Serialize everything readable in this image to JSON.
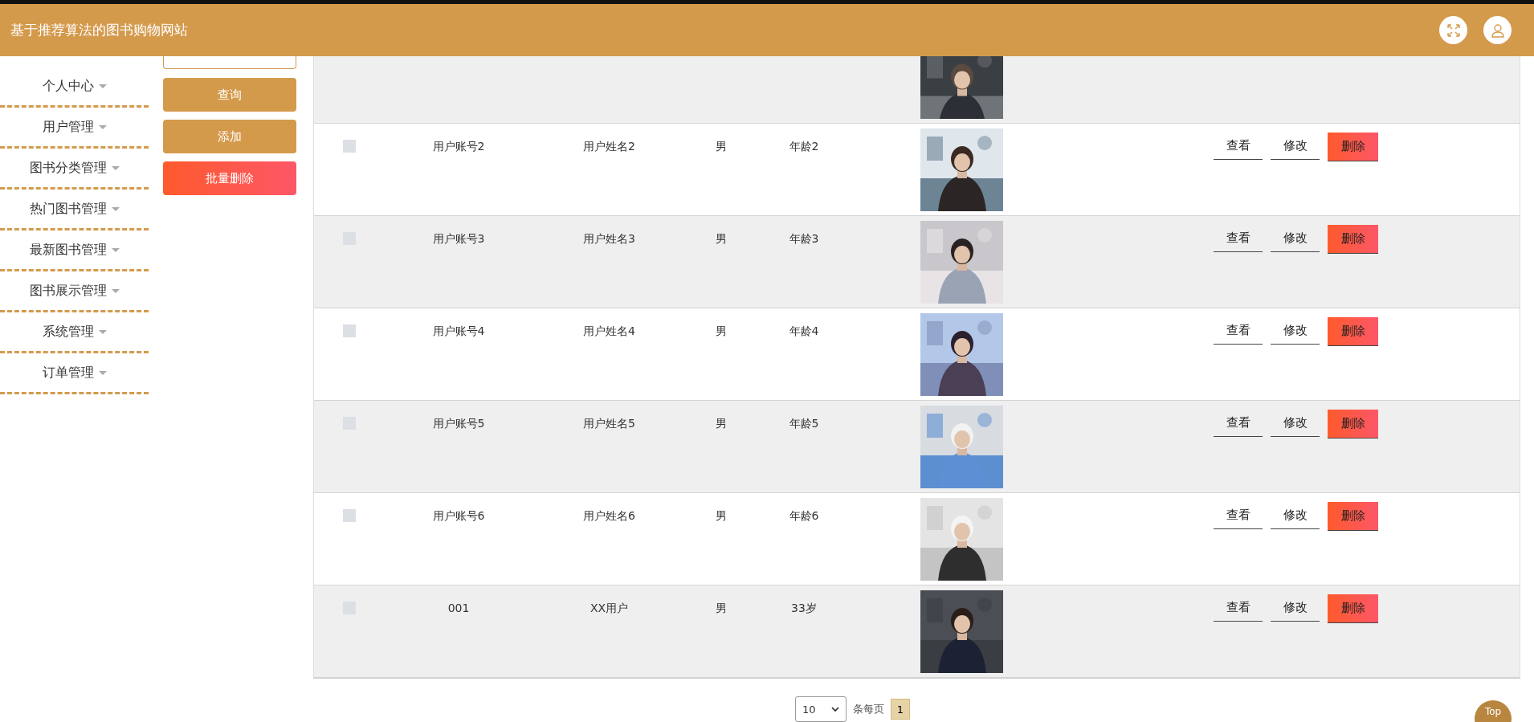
{
  "header": {
    "title": "基于推荐算法的图书购物网站"
  },
  "sidebar": {
    "items": [
      {
        "label": "个人中心"
      },
      {
        "label": "用户管理"
      },
      {
        "label": "图书分类管理"
      },
      {
        "label": "热门图书管理"
      },
      {
        "label": "最新图书管理"
      },
      {
        "label": "图书展示管理"
      },
      {
        "label": "系统管理"
      },
      {
        "label": "订单管理"
      }
    ]
  },
  "buttons": [
    {
      "label": "查询",
      "kind": "primary"
    },
    {
      "label": "添加",
      "kind": "primary"
    },
    {
      "label": "批量删除",
      "kind": "danger"
    }
  ],
  "table": {
    "rows": [
      {
        "kind": "partial"
      },
      {
        "kind": "full",
        "checked": false,
        "account": "用户账号2",
        "name": "用户姓名2",
        "sex": "男",
        "age": "年龄2",
        "actions": [
          "查看",
          "修改",
          "删除"
        ]
      },
      {
        "kind": "full",
        "checked": false,
        "account": "用户账号3",
        "name": "用户姓名3",
        "sex": "男",
        "age": "年龄3",
        "actions": [
          "查看",
          "修改",
          "删除"
        ]
      },
      {
        "kind": "full",
        "checked": false,
        "account": "用户账号4",
        "name": "用户姓名4",
        "sex": "男",
        "age": "年龄4",
        "actions": [
          "查看",
          "修改",
          "删除"
        ]
      },
      {
        "kind": "full",
        "checked": false,
        "account": "用户账号5",
        "name": "用户姓名5",
        "sex": "男",
        "age": "年龄5",
        "actions": [
          "查看",
          "修改",
          "删除"
        ]
      },
      {
        "kind": "full",
        "checked": false,
        "account": "用户账号6",
        "name": "用户姓名6",
        "sex": "男",
        "age": "年龄6",
        "actions": [
          "查看",
          "修改",
          "删除"
        ]
      },
      {
        "kind": "full",
        "checked": false,
        "account": "001",
        "name": "XX用户",
        "sex": "男",
        "age": "33岁",
        "actions": [
          "查看",
          "修改",
          "删除"
        ]
      }
    ]
  },
  "pagination": {
    "page_size": "10",
    "page_size_label": "条每页",
    "pages": [
      {
        "label": "1",
        "selected": true
      }
    ]
  },
  "top_button": "Top"
}
